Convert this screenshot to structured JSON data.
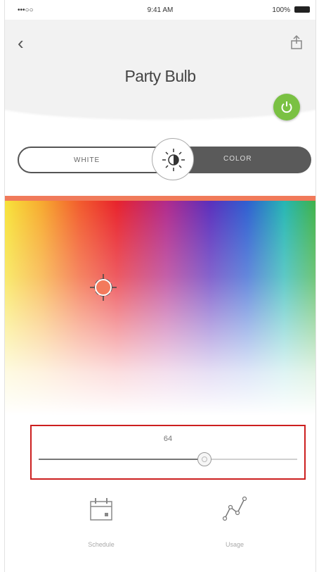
{
  "status_bar": {
    "signal": "•••○○ ",
    "time": "9:41 AM",
    "battery": "100%"
  },
  "header": {
    "title": "Party Bulb"
  },
  "mode_toggle": {
    "white_label": "WHITE",
    "color_label": "COLOR",
    "selected": "COLOR"
  },
  "color_picker": {
    "selected_color": "#f37a5c"
  },
  "brightness": {
    "value_label": "64",
    "value": 64
  },
  "bottom_nav": {
    "schedule_label": "Schedule",
    "usage_label": "Usage"
  },
  "colors": {
    "accent_green": "#7ac143",
    "highlight_red": "#cc1f1f"
  }
}
